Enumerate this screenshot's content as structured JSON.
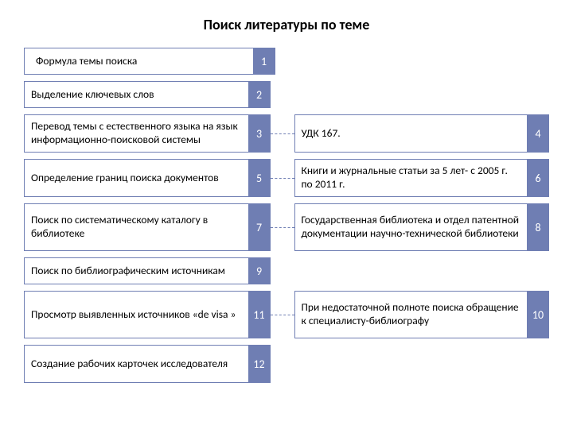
{
  "title": "Поиск литературы по теме",
  "rows": [
    {
      "left": "Формула темы поиска",
      "leftNum": "1"
    },
    {
      "left": "Выделение ключевых слов",
      "leftNum": "2"
    },
    {
      "left": "Перевод темы с естественного языка на язык информационно-поисковой системы",
      "leftNum": "3",
      "right": "УДК   167.",
      "rightNum": "4"
    },
    {
      "left": "Определение границ поиска документов",
      "leftNum": "5",
      "right": "Книги и журнальные статьи за 5 лет- с 2005 г. по 2011 г.",
      "rightNum": "6"
    },
    {
      "left": "Поиск по систематическому каталогу в библиотеке",
      "leftNum": "7",
      "right": "Государственная библиотека и отдел патентной документации научно-технической библиотеки",
      "rightNum": "8"
    },
    {
      "left": "Поиск по библиографическим источникам",
      "leftNum": "9"
    },
    {
      "left": "Просмотр выявленных источников «de visa »",
      "leftNum": "11",
      "right": "При недостаточной полноте поиска обращение к специалисту-библиографу",
      "rightNum": "10"
    },
    {
      "left": "Создание рабочих карточек исследователя",
      "leftNum": "12"
    }
  ]
}
